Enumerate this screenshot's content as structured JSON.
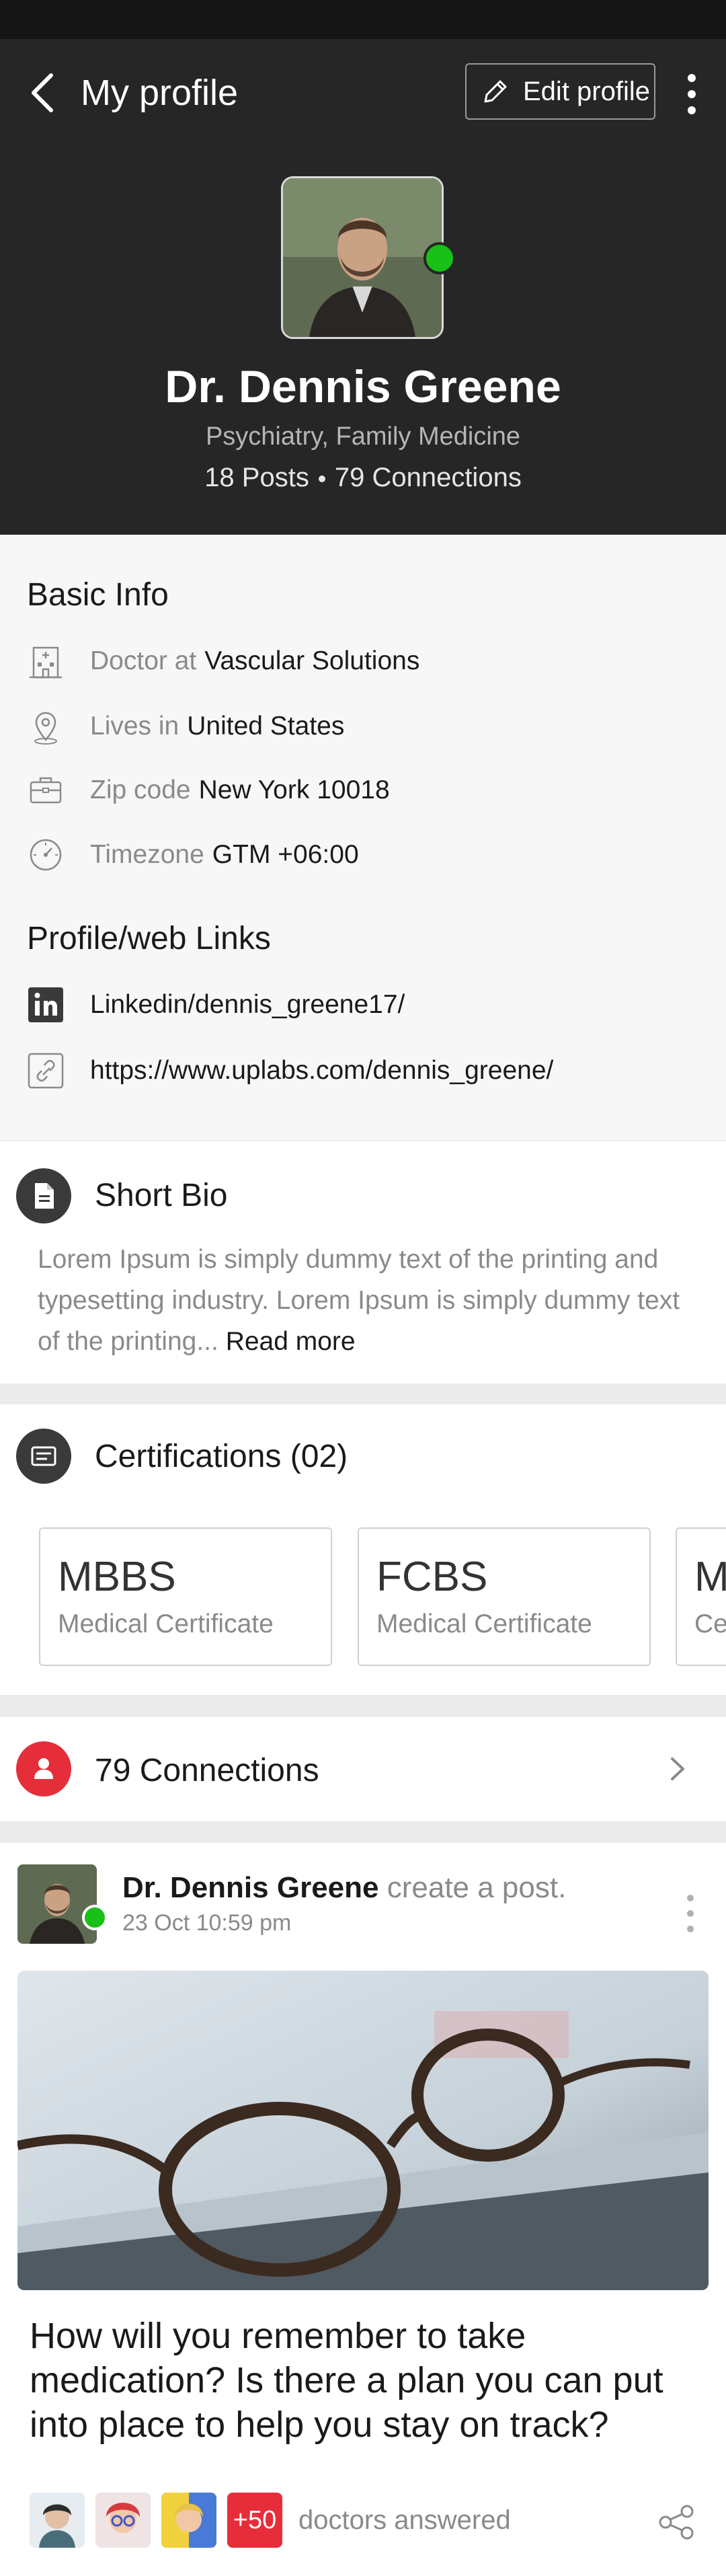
{
  "header": {
    "title": "My profile",
    "edit_label": "Edit profile"
  },
  "profile": {
    "name": "Dr. Dennis Greene",
    "specialty": "Psychiatry, Family Medicine",
    "posts": "18 Posts",
    "connections": "79 Connections",
    "online": true
  },
  "basic_info": {
    "title": "Basic Info",
    "rows": [
      {
        "icon": "hospital-icon",
        "label": "Doctor at",
        "value": "Vascular Solutions"
      },
      {
        "icon": "location-pin-icon",
        "label": "Lives in",
        "value": "United States"
      },
      {
        "icon": "briefcase-icon",
        "label": "Zip code",
        "value": "New York 10018"
      },
      {
        "icon": "clock-gauge-icon",
        "label": "Timezone",
        "value": "GTM +06:00"
      }
    ]
  },
  "links": {
    "title": "Profile/web Links",
    "items": [
      {
        "icon": "linkedin-icon",
        "text": "Linkedin/dennis_greene17/"
      },
      {
        "icon": "link-icon",
        "text": "https://www.uplabs.com/dennis_greene/"
      }
    ]
  },
  "bio": {
    "title": "Short Bio",
    "text": "Lorem Ipsum is simply dummy text of the printing and typesetting industry. Lorem Ipsum is simply dummy text of the printing...",
    "read_more": "Read more"
  },
  "certifications": {
    "title": "Certifications (02)",
    "items": [
      {
        "name": "MBBS",
        "subtitle": "Medical Certificate"
      },
      {
        "name": "FCBS",
        "subtitle": "Medical Certificate"
      },
      {
        "name": "M",
        "subtitle": "Ce"
      }
    ]
  },
  "connections_row": {
    "label": "79 Connections"
  },
  "post": {
    "author": "Dr. Dennis Greene",
    "action": "create a post.",
    "time": "23 Oct 10:59 pm",
    "question": "How will you remember to take medication? Is there a plan you can put into place to help you stay on track?",
    "answers_count": "+50",
    "answers_label": "doctors answered"
  },
  "colors": {
    "header_bg": "#262626",
    "online": "#18c018",
    "accent_red": "#e62e3b",
    "dark_icon": "#3a3a3a"
  }
}
